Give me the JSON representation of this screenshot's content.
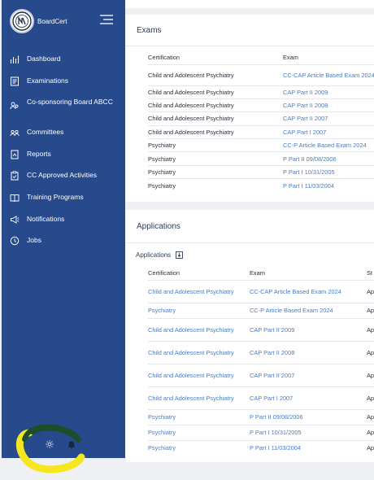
{
  "app": {
    "brand": "BoardCert"
  },
  "sidebar": {
    "items": [
      {
        "label": "Dashboard",
        "icon": "bar-chart-icon"
      },
      {
        "label": "Examinations",
        "icon": "document-icon"
      },
      {
        "label": "Co-sponsoring Board ABCC",
        "icon": "users-icon"
      },
      {
        "label": "Committees",
        "icon": "group-icon"
      },
      {
        "label": "Reports",
        "icon": "report-icon"
      },
      {
        "label": "CC Approved Activities",
        "icon": "clipboard-check-icon"
      },
      {
        "label": "Training Programs",
        "icon": "book-icon"
      },
      {
        "label": "Notifications",
        "icon": "megaphone-icon"
      },
      {
        "label": "Jobs",
        "icon": "clock-icon"
      }
    ],
    "footer": {
      "settings_icon": "gear-icon",
      "bell_icon": "bell-icon"
    }
  },
  "exams": {
    "title": "Exams",
    "columns": [
      "Certification",
      "Exam"
    ],
    "rows": [
      {
        "certification": "Child and Adolescent Psychiatry",
        "exam": "CC-CAP Article Based Exam 2024"
      },
      {
        "certification": "Child and Adolescent Psychiatry",
        "exam": "CAP Part II 2009"
      },
      {
        "certification": "Child and Adolescent Psychiatry",
        "exam": "CAP Part II 2008"
      },
      {
        "certification": "Child and Adolescent Psychiatry",
        "exam": "CAP Part II 2007"
      },
      {
        "certification": "Child and Adolescent Psychiatry",
        "exam": "CAP Part I 2007"
      },
      {
        "certification": "Psychiatry",
        "exam": "CC-P Article Based Exam 2024"
      },
      {
        "certification": "Psychiatry",
        "exam": "P Part II 09/08/2006"
      },
      {
        "certification": "Psychiatry",
        "exam": "P Part I 10/31/2005"
      },
      {
        "certification": "Psychiatry",
        "exam": "P Part I 11/03/2004"
      }
    ]
  },
  "applications": {
    "title": "Applications",
    "sublabel": "Applications",
    "columns": [
      "Certification",
      "Exam",
      "St"
    ],
    "rows": [
      {
        "certification": "Child and Adolescent Psychiatry",
        "exam": "CC-CAP Article Based Exam 2024",
        "status": "Ap"
      },
      {
        "certification": "Psychiatry",
        "exam": "CC-P Article Based Exam 2024",
        "status": "Ap"
      },
      {
        "certification": "Child and Adolescent Psychiatry",
        "exam": "CAP Part II 2009",
        "status": "Ap"
      },
      {
        "certification": "Child and Adolescent Psychiatry",
        "exam": "CAP Part II 2008",
        "status": "Ap"
      },
      {
        "certification": "Child and Adolescent Psychiatry",
        "exam": "CAP Part II 2007",
        "status": "Ap"
      },
      {
        "certification": "Child and Adolescent Psychiatry",
        "exam": "CAP Part I 2007",
        "status": "Ap"
      },
      {
        "certification": "Psychiatry",
        "exam": "P Part II 09/08/2006",
        "status": "Ap"
      },
      {
        "certification": "Psychiatry",
        "exam": "P Part I 10/31/2005",
        "status": "Ap"
      },
      {
        "certification": "Psychiatry",
        "exam": "P Part I 11/03/2004",
        "status": "Ap"
      }
    ]
  },
  "colors": {
    "sidebar": "#274a8c",
    "link": "#4a7cc4",
    "highlight": "#f5e61e"
  }
}
